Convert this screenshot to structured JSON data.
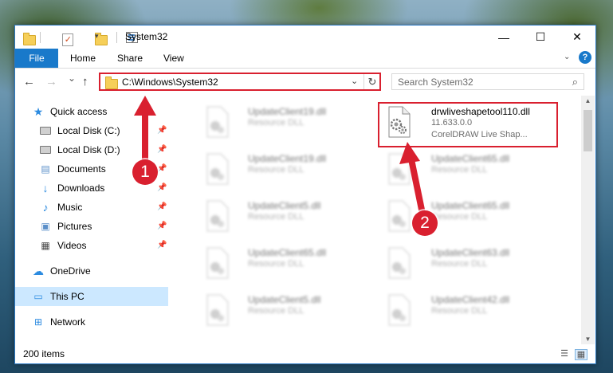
{
  "window": {
    "title": "System32",
    "controls": {
      "minimize": "—",
      "maximize": "☐",
      "close": "✕"
    }
  },
  "ribbon": {
    "tabs": [
      "File",
      "Home",
      "Share",
      "View"
    ],
    "help": "?"
  },
  "navigation": {
    "back": "←",
    "forward": "→",
    "recent": "⌄",
    "up": "↑",
    "address": "C:\\Windows\\System32",
    "refresh": "↻",
    "search_placeholder": "Search System32",
    "search_icon": "⌕"
  },
  "sidebar": {
    "items": [
      {
        "label": "Quick access",
        "icon": "star-icon",
        "pinned": false
      },
      {
        "label": "Local Disk (C:)",
        "icon": "drive-icon",
        "pinned": true
      },
      {
        "label": "Local Disk (D:)",
        "icon": "drive-icon",
        "pinned": true
      },
      {
        "label": "Documents",
        "icon": "documents-icon",
        "pinned": true
      },
      {
        "label": "Downloads",
        "icon": "download-icon",
        "pinned": true
      },
      {
        "label": "Music",
        "icon": "music-icon",
        "pinned": true
      },
      {
        "label": "Pictures",
        "icon": "pictures-icon",
        "pinned": true
      },
      {
        "label": "Videos",
        "icon": "videos-icon",
        "pinned": true
      },
      {
        "label": "OneDrive",
        "icon": "cloud-icon",
        "pinned": false
      },
      {
        "label": "This PC",
        "icon": "computer-icon",
        "pinned": false,
        "selected": true
      },
      {
        "label": "Network",
        "icon": "network-icon",
        "pinned": false
      }
    ]
  },
  "files": {
    "highlighted": {
      "name": "drwliveshapetool110.dll",
      "version": "11.633.0.0",
      "description": "CorelDRAW Live Shap..."
    },
    "left_column": [
      {
        "name": "UpdateClient19.dll",
        "type": "Resource DLL"
      },
      {
        "name": "UpdateClient19.dll",
        "type": "Resource DLL"
      },
      {
        "name": "UpdateClient5.dll",
        "type": "Resource DLL"
      },
      {
        "name": "UpdateClient65.dll",
        "type": "Resource DLL"
      },
      {
        "name": "UpdateClient5.dll",
        "type": "Resource DLL"
      }
    ],
    "right_column": [
      {
        "name": "UpdateClient65.dll",
        "type": "Resource DLL"
      },
      {
        "name": "UpdateClient65.dll",
        "type": "Resource DLL"
      },
      {
        "name": "UpdateClient63.dll",
        "type": "Resource DLL"
      },
      {
        "name": "UpdateClient42.dll",
        "type": "Resource DLL"
      }
    ]
  },
  "status": {
    "item_count": "200 items"
  },
  "annotations": {
    "step1": "1",
    "step2": "2",
    "color": "#d9202f"
  },
  "colors": {
    "accent": "#1979ca",
    "selection": "#cce8ff",
    "highlight_border": "#d9202f"
  }
}
